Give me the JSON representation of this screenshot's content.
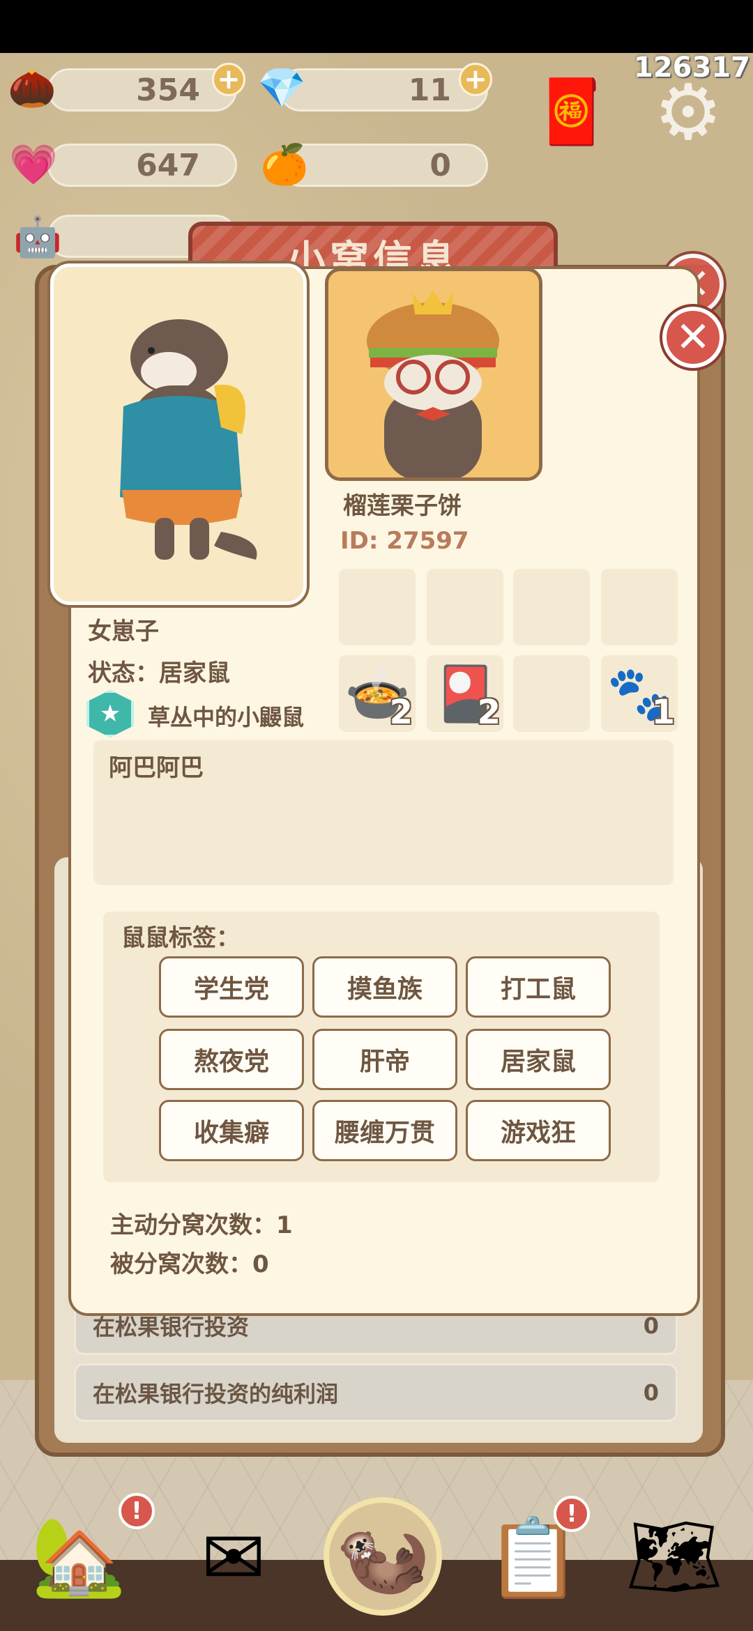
{
  "counter": "126317",
  "resources": {
    "acorn": {
      "value": "354",
      "icon": "acorn-icon"
    },
    "crystal": {
      "value": "11",
      "icon": "crystal-icon"
    },
    "heart": {
      "value": "647",
      "icon": "heart-icon"
    },
    "orange": {
      "value": "0",
      "icon": "orange-icon"
    }
  },
  "window_title": "小窝信息",
  "profile": {
    "name": "榴莲栗子饼",
    "id_text": "ID: 27597",
    "nickname": "女崽子",
    "status": "状态：居家鼠",
    "title_badge": "草丛中的小鼹鼠",
    "signature": "阿巴阿巴"
  },
  "items": [
    {
      "icon": "pot-icon",
      "count": "2"
    },
    {
      "icon": "cards-icon",
      "count": "2"
    },
    {
      "icon": "paw-icon",
      "count": "1"
    }
  ],
  "tags": {
    "header": "鼠鼠标签：",
    "list": [
      "学生党",
      "摸鱼族",
      "打工鼠",
      "熬夜党",
      "肝帝",
      "居家鼠",
      "收集癖",
      "腰缠万贯",
      "游戏狂"
    ]
  },
  "counts": {
    "active": "主动分窝次数：1",
    "passive": "被分窝次数：0"
  },
  "back_rows": [
    {
      "label": "在松果银行投资",
      "value": "0"
    },
    {
      "label": "在松果银行投资的纯利润",
      "value": "0"
    }
  ],
  "colors": {
    "accent": "#d7574c",
    "panel": "#fdf6e3",
    "text": "#6e5641"
  }
}
